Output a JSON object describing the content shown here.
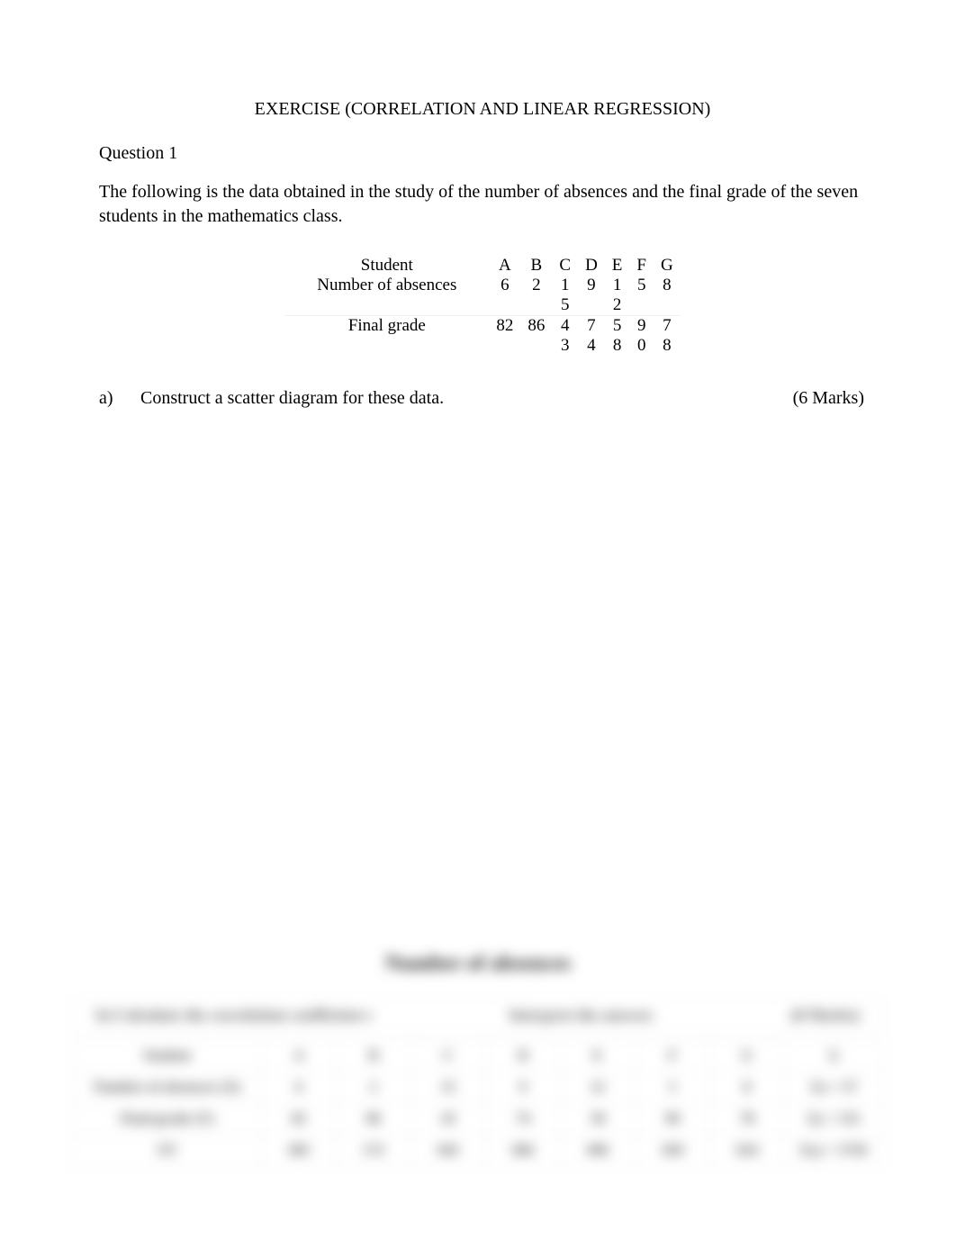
{
  "title": "EXERCISE (CORRELATION AND LINEAR REGRESSION)",
  "question_heading": "Question 1",
  "intro": "The following is the data obtained in the study of the number of absences and the final grade of the seven students in the mathematics class.",
  "table": {
    "row1_label": "Student",
    "row1": [
      "A",
      "B",
      "C",
      "D",
      "E",
      "F",
      "G"
    ],
    "row2_label": "Number of absences",
    "row2_top": [
      "6",
      "2",
      "1",
      "9",
      "1",
      "5",
      "8"
    ],
    "row2_bot": [
      "",
      "",
      "5",
      "",
      "2",
      "",
      ""
    ],
    "row3_label": "Final grade",
    "row3_top": [
      "82",
      "86",
      "4",
      "7",
      "5",
      "9",
      "7"
    ],
    "row3_bot": [
      "",
      "",
      "3",
      "4",
      "8",
      "0",
      "8"
    ]
  },
  "part_a": {
    "letter": "a)",
    "text": "Construct a scatter diagram for these data.",
    "marks": "(6 Marks)"
  },
  "blur": {
    "axis_title": "Number of absences",
    "part_b_left": "b)  Calculate the correlation coefficient r",
    "part_b_mid": "Interpret the answer.",
    "part_b_right": "(8 Marks)",
    "t": {
      "labels": [
        "Student",
        "Number of absences (X)",
        "Final grade (Y)",
        "XY"
      ],
      "rows": [
        [
          "A",
          "B",
          "C",
          "D",
          "E",
          "F",
          "G",
          "Σ"
        ],
        [
          "6",
          "2",
          "15",
          "9",
          "12",
          "5",
          "8",
          "Σx = 57"
        ],
        [
          "82",
          "86",
          "43",
          "74",
          "58",
          "90",
          "78",
          "Σy = 511"
        ],
        [
          "492",
          "172",
          "645",
          "666",
          "696",
          "450",
          "624",
          "Σxy = 3745"
        ]
      ]
    }
  }
}
